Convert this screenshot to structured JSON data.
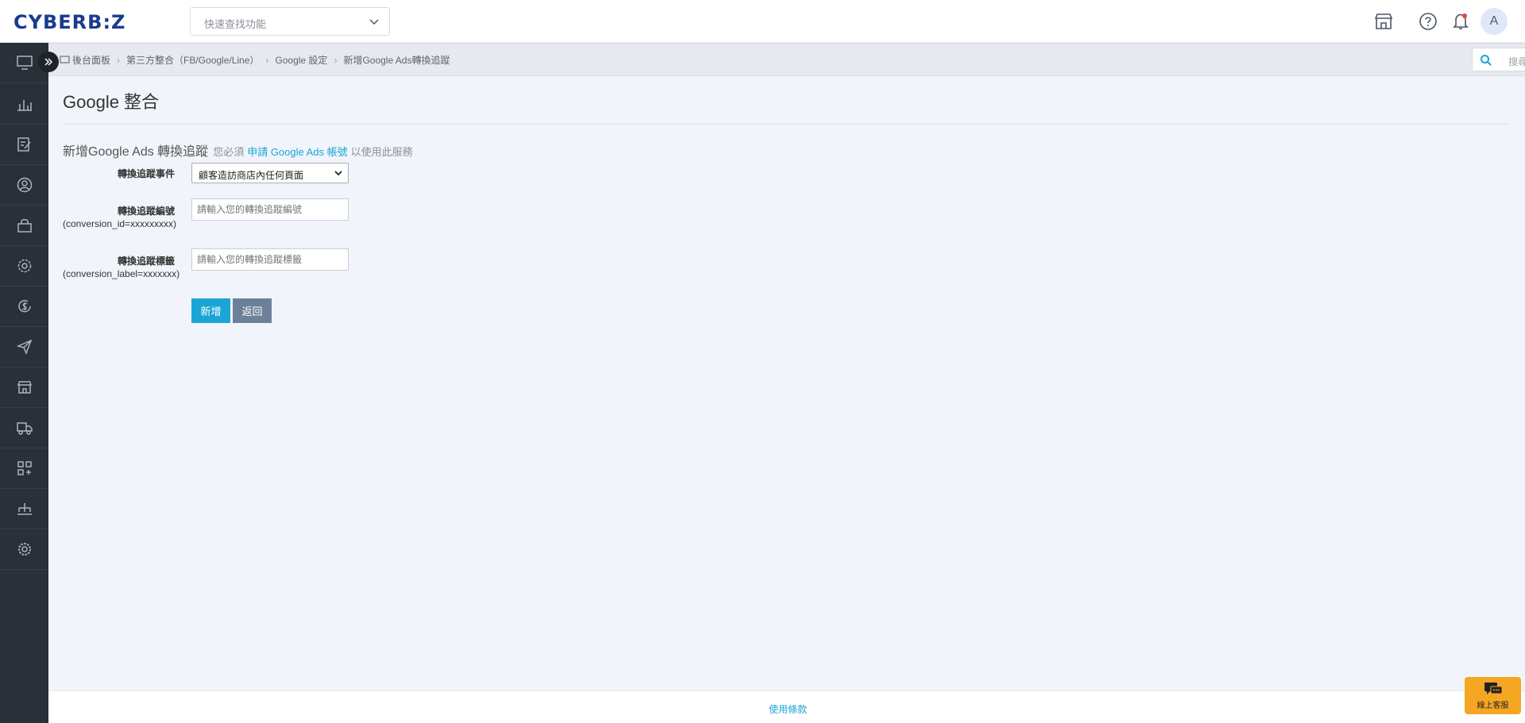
{
  "header": {
    "logo": "CYBERB:Z",
    "quick_search_placeholder": "快速查找功能",
    "avatar_letter": "A"
  },
  "breadcrumb": {
    "items": [
      "後台面板",
      "第三方整合（FB/Google/Line）",
      "Google 設定",
      "新增Google Ads轉換追蹤"
    ],
    "search_placeholder": "搜尋.."
  },
  "main": {
    "title": "Google 整合",
    "section_title": "新增Google Ads 轉換追蹤",
    "note_prefix": "您必須",
    "note_link": "申請 Google Ads 帳號",
    "note_suffix": "以使用此服務",
    "fields": {
      "event_label": "轉換追蹤事件",
      "event_value": "顧客造訪商店內任何頁面",
      "id_label": "轉換追蹤編號",
      "id_sublabel": "(conversion_id=xxxxxxxxx)",
      "id_placeholder": "請輸入您的轉換追蹤編號",
      "tag_label": "轉換追蹤標籤",
      "tag_sublabel": "(conversion_label=xxxxxxx)",
      "tag_placeholder": "請輸入您的轉換追蹤標籤"
    },
    "buttons": {
      "add": "新增",
      "back": "返回"
    }
  },
  "footer": {
    "terms": "使用條款"
  },
  "chat": {
    "label": "線上客服"
  },
  "colors": {
    "accent": "#1aa5d6",
    "sidebar": "#2a3038",
    "back_button": "#6c8099",
    "chat": "#f5a623"
  }
}
